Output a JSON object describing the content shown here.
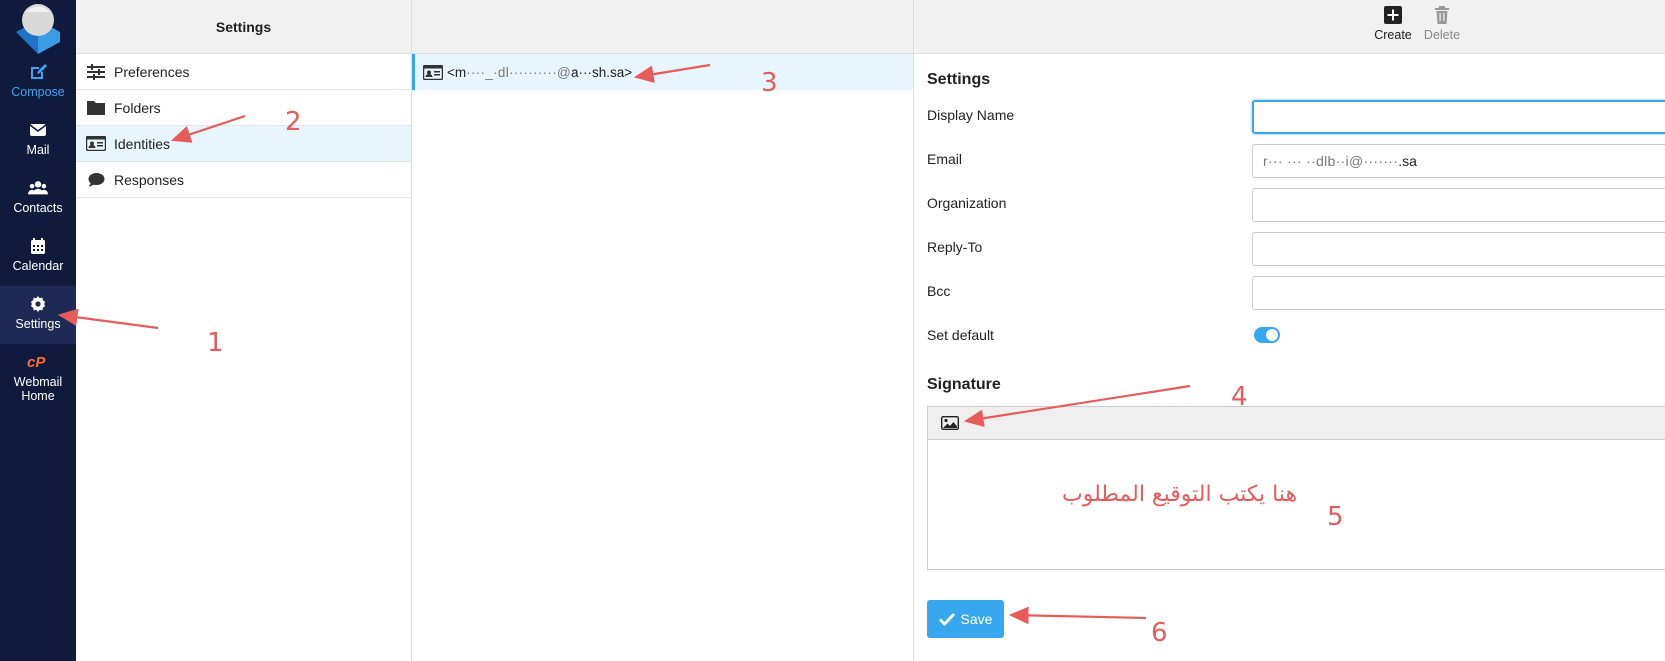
{
  "nav": {
    "items": [
      {
        "label": "Compose",
        "icon": "compose-icon"
      },
      {
        "label": "Mail",
        "icon": "mail-icon"
      },
      {
        "label": "Contacts",
        "icon": "contacts-icon"
      },
      {
        "label": "Calendar",
        "icon": "calendar-icon"
      },
      {
        "label": "Settings",
        "icon": "gear-icon"
      },
      {
        "label_line1": "Webmail",
        "label_line2": "Home",
        "icon": "cpanel-icon"
      }
    ],
    "accent": "#37a8f0",
    "background": "#0f1a3d"
  },
  "settings_column": {
    "header": "Settings",
    "menu": [
      {
        "label": "Preferences",
        "icon": "sliders-icon"
      },
      {
        "label": "Folders",
        "icon": "folder-icon"
      },
      {
        "label": "Identities",
        "icon": "id-card-icon"
      },
      {
        "label": "Responses",
        "icon": "comment-icon"
      }
    ]
  },
  "identities_column": {
    "rows": [
      {
        "prefix": "<m",
        "masked": "····_·dl··········@",
        "suffix": "a···sh.sa>"
      }
    ]
  },
  "toolbar": {
    "create_label": "Create",
    "delete_label": "Delete"
  },
  "form": {
    "section_title": "Settings",
    "display_name_label": "Display Name",
    "display_name_value": "",
    "email_label": "Email",
    "email_masked": "r··· ··· ··dlb··i@·······",
    "email_suffix": ".sa",
    "organization_label": "Organization",
    "reply_to_label": "Reply-To",
    "bcc_label": "Bcc",
    "set_default_label": "Set default",
    "set_default_on": true
  },
  "signature": {
    "title": "Signature",
    "toolbar_icon": "image-icon"
  },
  "save_label": "Save",
  "annotations": {
    "n1": "1",
    "n2": "2",
    "n3": "3",
    "n4": "4",
    "n5": "5",
    "n6": "6",
    "arabic_note": "هنا يكتب التوقيع المطلوب",
    "color": "#e85b5b"
  }
}
